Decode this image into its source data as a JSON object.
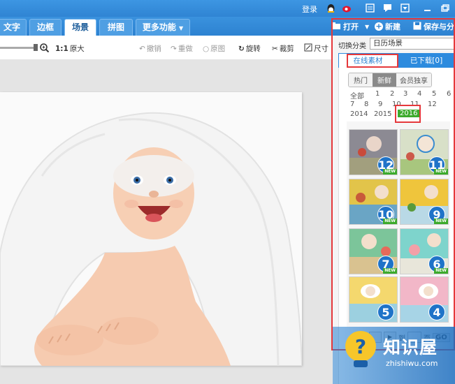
{
  "titlebar": {
    "login": "登录"
  },
  "menu": {
    "tabs": [
      {
        "label": "文字"
      },
      {
        "label": "边框"
      },
      {
        "label": "场景"
      },
      {
        "label": "拼图"
      },
      {
        "label": "更多功能"
      }
    ],
    "open": "打开",
    "new": "新建",
    "save": "保存与分"
  },
  "toolbar": {
    "one_to_one": "1:1",
    "original": "原大",
    "undo": "撤销",
    "redo": "重做",
    "reset": "原图",
    "rotate": "旋转",
    "crop": "裁剪",
    "size": "尺寸"
  },
  "panel": {
    "switch_label": "切换分类",
    "category_value": "日历场景",
    "tab_online": "在线素材",
    "tab_downloaded": "已下载[0]",
    "filters": [
      "热门",
      "新鲜",
      "会员独享"
    ],
    "years_row1": [
      "全部",
      "1",
      "2",
      "3",
      "4",
      "5",
      "6"
    ],
    "years_row2": [
      "7",
      "8",
      "9",
      "10",
      "11",
      "12"
    ],
    "years_row3": [
      "2014",
      "2015",
      "2016"
    ],
    "thumbnails": [
      "12",
      "11",
      "10",
      "9",
      "7",
      "6",
      "5",
      "4"
    ],
    "new_label": "NEW",
    "pager": {
      "to": "到",
      "page": "页",
      "go": "GO"
    }
  },
  "watermark": {
    "title": "知识屋",
    "domain": "zhishiwu.com"
  },
  "colors": {
    "accent": "#2f84d3",
    "highlight": "#e5383b",
    "selected_year": "#3caa2c"
  }
}
